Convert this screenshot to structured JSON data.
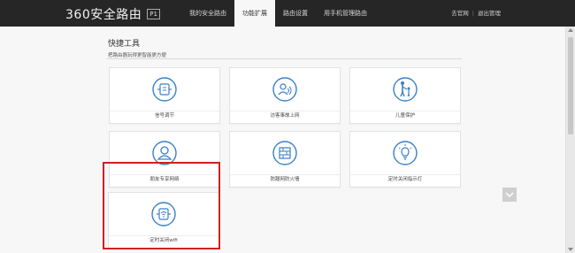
{
  "header": {
    "logo_text": "360安全路由",
    "model_badge": "P1",
    "nav": [
      {
        "label": "我的安全路由",
        "active": false
      },
      {
        "label": "功能扩展",
        "active": true
      },
      {
        "label": "路由设置",
        "active": false
      },
      {
        "label": "用手机管理路由",
        "active": false
      }
    ],
    "links": {
      "official_site": "去官网",
      "separator": "|",
      "logout": "退出管理"
    }
  },
  "main": {
    "title": "快捷工具",
    "subtitle": "把路由器玩得更智能更方便",
    "tools": [
      {
        "label": "信号调节",
        "icon": "signal-adjust-icon"
      },
      {
        "label": "访客事故上网",
        "icon": "guest-wifi-icon"
      },
      {
        "label": "儿童保护",
        "icon": "child-protection-icon"
      },
      {
        "label": "朋友专享网络",
        "icon": "friend-network-icon"
      },
      {
        "label": "防蹭网防火墙",
        "icon": "firewall-icon"
      },
      {
        "label": "定时关闭指示灯",
        "icon": "lightbulb-icon"
      },
      {
        "label": "定时关闭wifi",
        "icon": "scheduled-wifi-icon"
      }
    ]
  },
  "colors": {
    "topbar": "#262626",
    "accent_icon": "#3a7fc4",
    "highlight": "#d02020"
  }
}
